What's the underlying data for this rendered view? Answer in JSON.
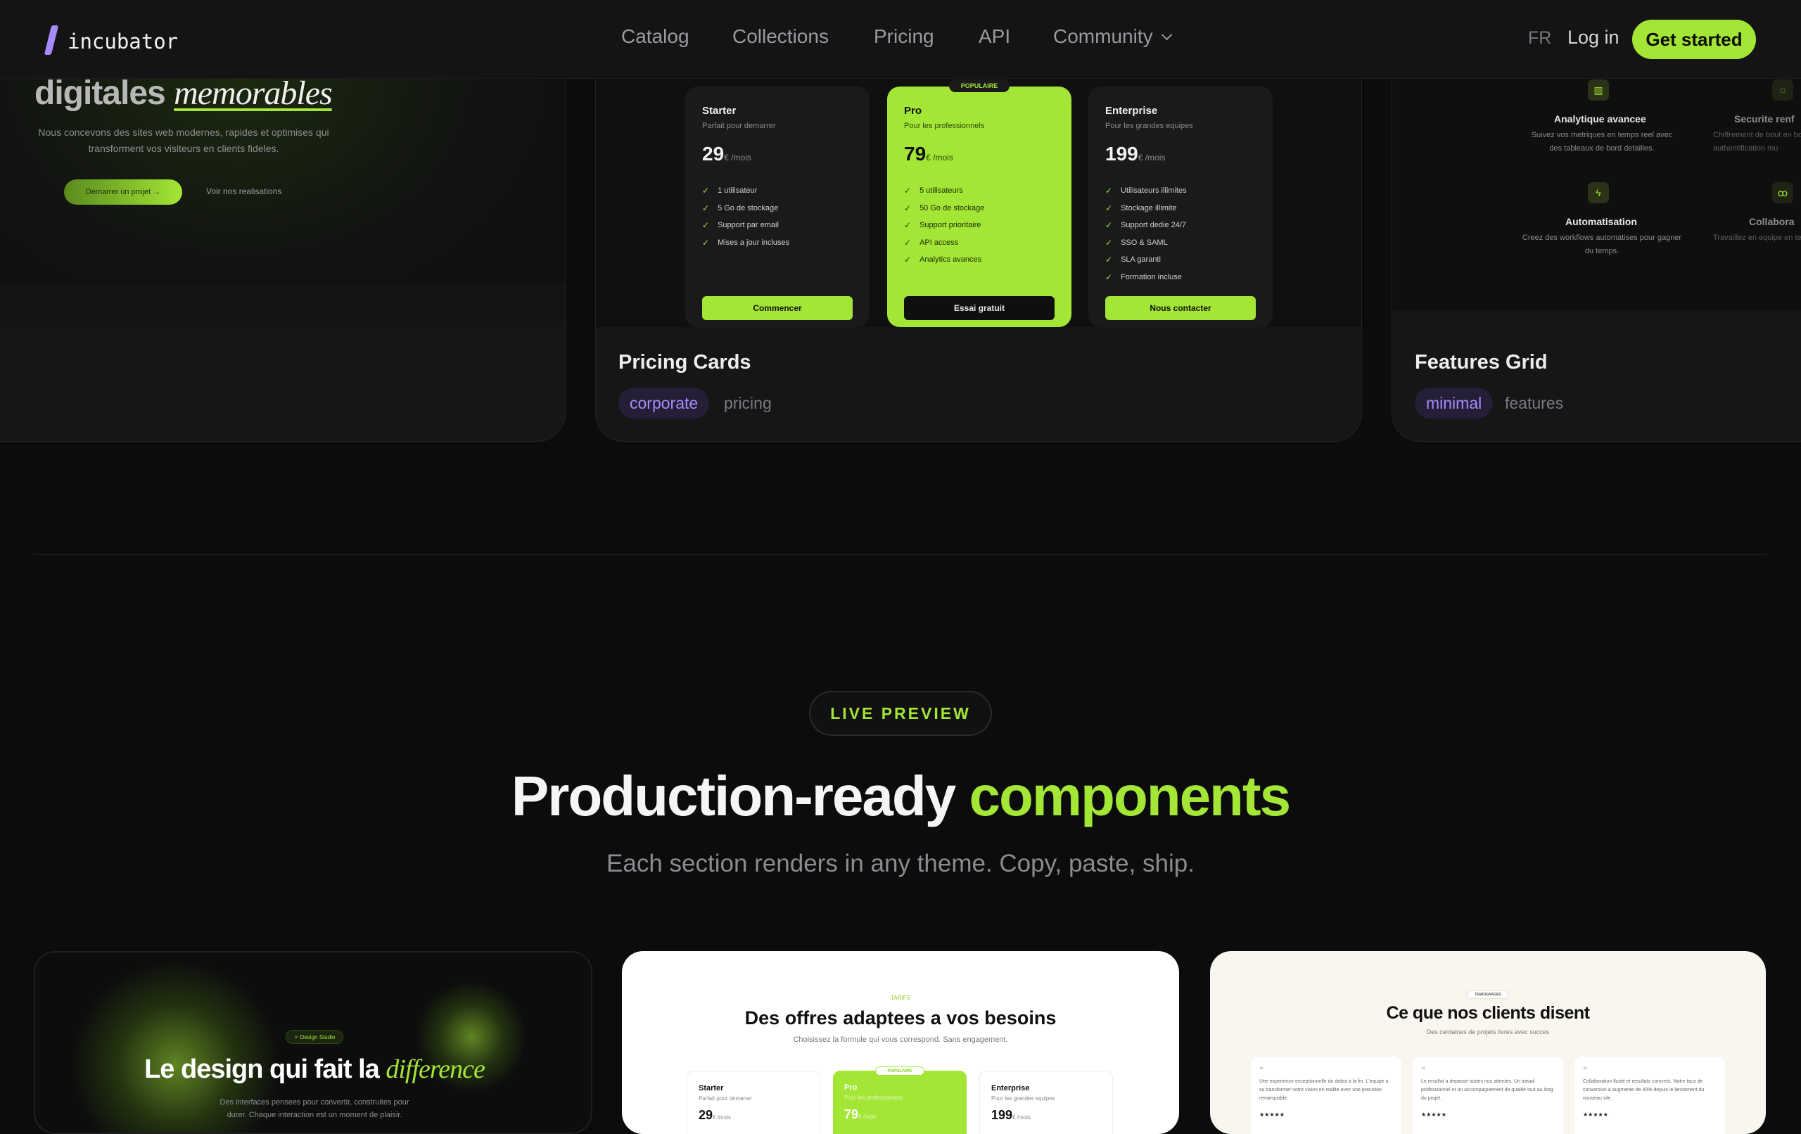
{
  "nav": {
    "logo": "incubator",
    "links": [
      "Catalog",
      "Collections",
      "Pricing",
      "API",
      "Community"
    ],
    "lang": "FR",
    "login": "Log in",
    "cta": "Get started"
  },
  "hero_card": {
    "headline_main": "digitales",
    "headline_em": "memorables",
    "desc": "Nous concevons des sites web modernes, rapides et optimises qui transforment vos visiteurs en clients fideles.",
    "primary_btn": "Demarrer un projet",
    "secondary_btn": "Voir nos realisations"
  },
  "pricing_card": {
    "title": "Pricing Cards",
    "tags": [
      "corporate",
      "pricing"
    ],
    "popular": "POPULAIRE",
    "plans": [
      {
        "name": "Starter",
        "desc": "Parfait pour demarrer",
        "price": "29",
        "unit": "€ /mois",
        "features": [
          "1 utilisateur",
          "5 Go de stockage",
          "Support par email",
          "Mises a jour incluses"
        ],
        "button": "Commencer"
      },
      {
        "name": "Pro",
        "desc": "Pour les professionnels",
        "price": "79",
        "unit": "€ /mois",
        "features": [
          "5 utilisateurs",
          "50 Go de stockage",
          "Support prioritaire",
          "API access",
          "Analytics avances"
        ],
        "button": "Essai gratuit"
      },
      {
        "name": "Enterprise",
        "desc": "Pour les grandes equipes",
        "price": "199",
        "unit": "€ /mois",
        "features": [
          "Utilisateurs illimites",
          "Stockage illimite",
          "Support dedie 24/7",
          "SSO & SAML",
          "SLA garanti",
          "Formation incluse"
        ],
        "button": "Nous contacter"
      }
    ]
  },
  "features_card": {
    "title": "Features Grid",
    "tags": [
      "minimal",
      "features"
    ],
    "items": [
      {
        "title": "Analytique avancee",
        "desc": "Suivez vos metriques en temps reel avec des tableaux de bord detailles."
      },
      {
        "title": "Securite renf",
        "desc": "Chiffrement de bout en bout et authentification mu"
      },
      {
        "title": "Automatisation",
        "desc": "Creez des workflows automatises pour gagner du temps."
      },
      {
        "title": "Collabora",
        "desc": "Travaillez en equipe en temps reel sur vos"
      }
    ]
  },
  "live": {
    "badge": "LIVE PREVIEW",
    "headline_a": "Production-ready",
    "headline_b": "components",
    "sub": "Each section renders in any theme. Copy, paste, ship."
  },
  "preview1": {
    "pill": "Design Studio",
    "title_a": "Le design qui fait la",
    "title_em": "difference",
    "desc": "Des interfaces pensees pour convertir, construites pour durer. Chaque interaction est un moment de plaisir."
  },
  "preview2": {
    "eyebrow": "TARIFS",
    "title": "Des offres adaptees a vos besoins",
    "sub": "Choisissez la formule qui vous correspond. Sans engagement.",
    "popular": "POPULAIRE",
    "plans": [
      {
        "name": "Starter",
        "desc": "Parfait pour demarrer",
        "price": "29",
        "unit": "€ /mois"
      },
      {
        "name": "Pro",
        "desc": "Pour les professionnels",
        "price": "79",
        "unit": "€ /mois"
      },
      {
        "name": "Enterprise",
        "desc": "Pour les grandes equipes",
        "price": "199",
        "unit": "€ /mois"
      }
    ]
  },
  "preview3": {
    "eyebrow": "TEMOIGNAGES",
    "title": "Ce que nos clients disent",
    "sub": "Des centaines de projets livres avec succes",
    "quotes": [
      "Une experience exceptionnelle du debut a la fin. L'equipe a su transformer notre vision en realite avec une precision remarquable.",
      "Le resultat a depasse toutes nos attentes. Un travail professionnel et un accompagnement de qualite tout au long du projet.",
      "Collaboration fluide et resultats concrets. Notre taux de conversion a augmente de 40% depuis le lancement du nouveau site."
    ],
    "stars": "★★★★★"
  },
  "colors": {
    "accent": "#a3e635",
    "purple": "#a78bfa",
    "bg": "#0c0c0d"
  }
}
